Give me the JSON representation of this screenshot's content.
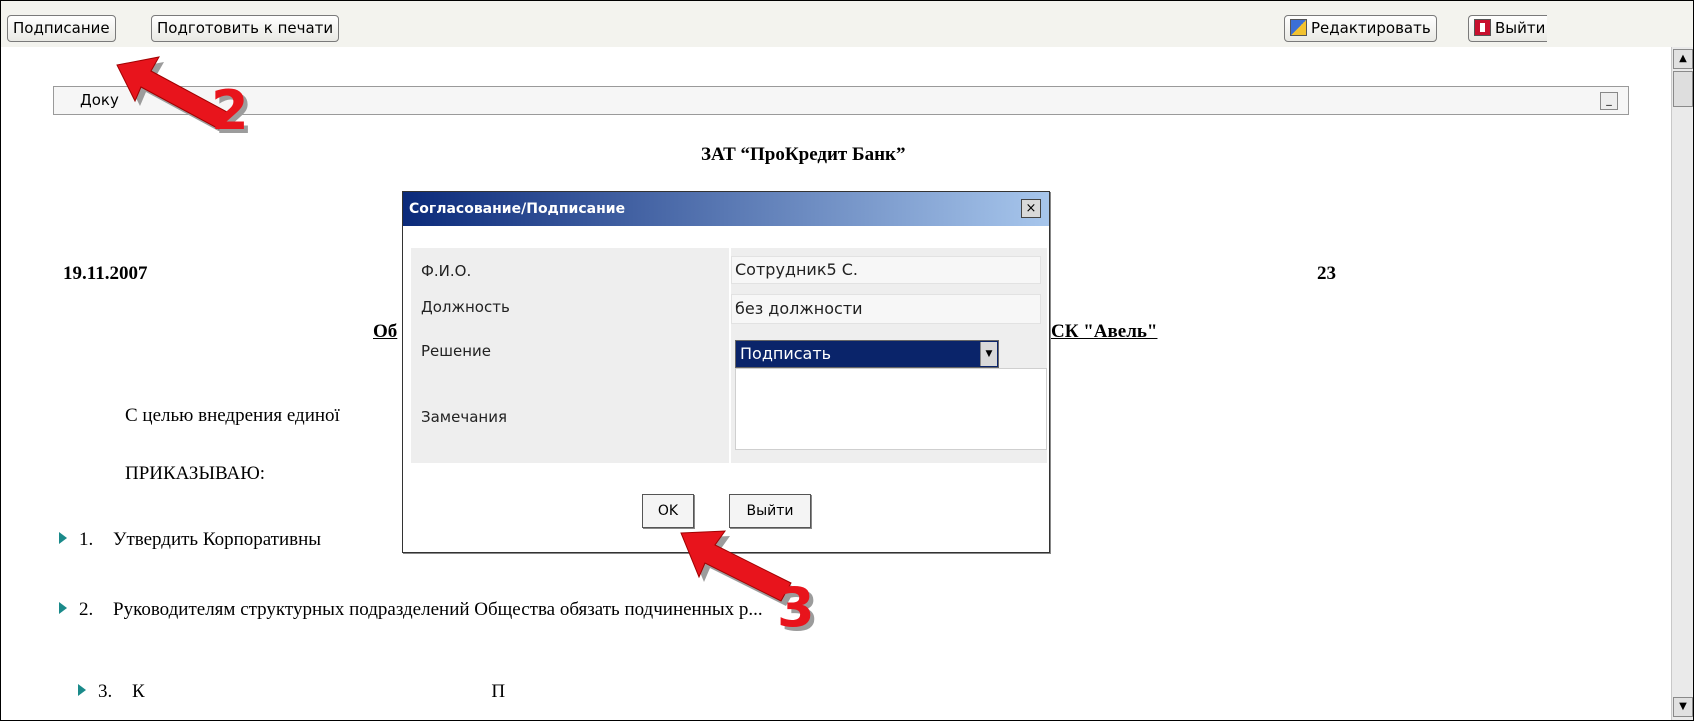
{
  "toolbar": {
    "sign_label": "Подписание",
    "print_label": "Подготовить к печати",
    "edit_label": "Редактировать",
    "exit_label": "Выйти",
    "edit_icon": "edit-icon",
    "exit_icon": "exit-door-icon"
  },
  "docbar": {
    "label": "Доку",
    "minimize_glyph": "_"
  },
  "document": {
    "title": "ЗАТ “ПроКредит Банк”",
    "date": "19.11.2007",
    "number": "23",
    "subject_left": "Об",
    "subject_right": "СК \"Авель\"",
    "paragraph": "С целью внедрения единої",
    "order": "ПРИКАЗЫВАЮ:",
    "items": [
      {
        "num": "1.",
        "text": "Утвердить Корпоративны"
      },
      {
        "num": "2.",
        "text": "Руководителям структурных подразделений Общества обязать подчиненных р..."
      },
      {
        "num": "3.",
        "text": "К                                                                         П"
      }
    ]
  },
  "dialog": {
    "title": "Согласование/Подписание",
    "close_glyph": "×",
    "fio_label": "Ф.И.О.",
    "fio_value": "Сотрудник5 С.",
    "position_label": "Должность",
    "position_value": "без должности",
    "decision_label": "Решение",
    "decision_value": "Подписать",
    "remarks_label": "Замечания",
    "ok_label": "OK",
    "exit_label": "Выйти"
  },
  "annotations": {
    "step2": "2",
    "step3": "3"
  },
  "scrollbar": {
    "up_glyph": "▲",
    "down_glyph": "▼"
  },
  "colors": {
    "dialog_title_start": "#0b2a7a",
    "dialog_title_end": "#a7c6ec",
    "selection": "#0a246a",
    "annotation_red": "#e8141c",
    "bullet": "#1a8a8a"
  }
}
